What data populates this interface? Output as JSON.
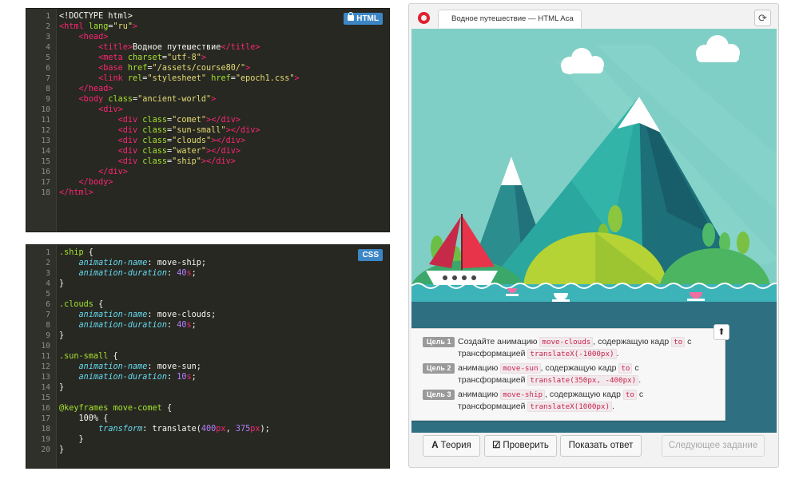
{
  "html_editor": {
    "badge": "HTML",
    "lines": [
      "<!DOCTYPE html>",
      "<html lang=\"ru\">",
      "    <head>",
      "        <title>Водное путешествие</title>",
      "        <meta charset=\"utf-8\">",
      "        <base href=\"/assets/course80/\">",
      "        <link rel=\"stylesheet\" href=\"epoch1.css\">",
      "    </head>",
      "    <body class=\"ancient-world\">",
      "        <div>",
      "            <div class=\"comet\"></div>",
      "            <div class=\"sun-small\"></div>",
      "            <div class=\"clouds\"></div>",
      "            <div class=\"water\"></div>",
      "            <div class=\"ship\"></div>",
      "        </div>",
      "    </body>",
      "</html>"
    ]
  },
  "css_editor": {
    "badge": "CSS",
    "lines": [
      ".ship {",
      "    animation-name: move-ship;",
      "    animation-duration: 40s;",
      "}",
      "",
      ".clouds {",
      "    animation-name: move-clouds;",
      "    animation-duration: 40s;",
      "}",
      "",
      ".sun-small {",
      "    animation-name: move-sun;",
      "    animation-duration: 10s;",
      "}",
      "",
      "@keyframes move-comet {",
      "    100% {",
      "        transform: translate(400px, 375px);",
      "    }",
      "}"
    ]
  },
  "browser": {
    "tab_title": "Водное путешествие — HTML Aca",
    "reload_icon": "reload-icon"
  },
  "tasks": [
    {
      "label": "Цель 1",
      "parts": [
        "Создайте анимацию ",
        "move-clouds",
        ", содержащую кадр ",
        "to",
        " с трансформацией ",
        "translateX(-1000px)",
        "."
      ]
    },
    {
      "label": "Цель 2",
      "parts": [
        "анимацию ",
        "move-sun",
        ", содержащую кадр ",
        "to",
        " с трансформацией ",
        "translate(350px, -400px)",
        "."
      ]
    },
    {
      "label": "Цель 3",
      "parts": [
        "анимацию ",
        "move-ship",
        ", содержащую кадр ",
        "to",
        " с трансформацией ",
        "translateX(1000px)",
        "."
      ]
    }
  ],
  "buttons": {
    "theory": "Теория",
    "check": "Проверить",
    "show_answer": "Показать ответ",
    "next_task": "Следующее задание"
  },
  "colors": {
    "sky": "#7fcfc5",
    "sea": "#2e6f82",
    "accent_red": "#e0202c"
  }
}
